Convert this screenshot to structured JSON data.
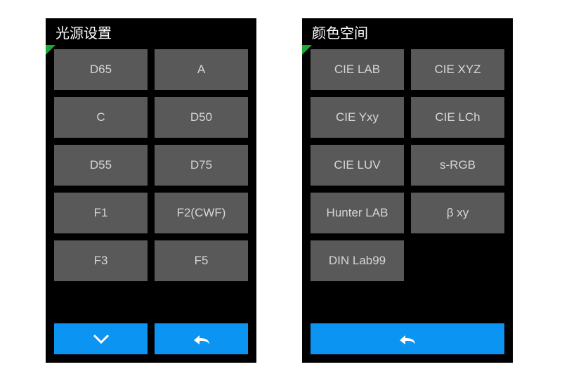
{
  "screens": [
    {
      "title": "光源设置",
      "options": [
        "D65",
        "A",
        "C",
        "D50",
        "D55",
        "D75",
        "F1",
        "F2(CWF)",
        "F3",
        "F5"
      ],
      "has_down": true
    },
    {
      "title": "颜色空间",
      "options": [
        "CIE LAB",
        "CIE XYZ",
        "CIE Yxy",
        "CIE LCh",
        "CIE LUV",
        "s-RGB",
        "Hunter LAB",
        "β xy",
        "DIN Lab99"
      ],
      "has_down": false
    }
  ],
  "colors": {
    "accent": "#0b94f2",
    "option_bg": "#595959",
    "option_fg": "#d6d6d6",
    "corner": "#1fa83a"
  }
}
